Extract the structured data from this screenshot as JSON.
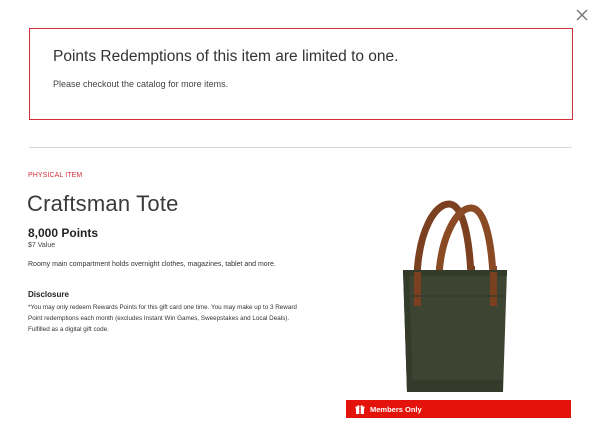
{
  "dialog": {
    "close_icon": "close-icon"
  },
  "alert": {
    "title": "Points Redemptions of this item are limited to one.",
    "message": "Please checkout the catalog for more items.",
    "border_color": "#d0303b"
  },
  "product": {
    "category": "PHYSICAL ITEM",
    "name": "Craftsman Tote",
    "points": "8,000 Points",
    "value": "$7 Value",
    "description": "Roomy main compartment holds overnight clothes, magazines, tablet and more.",
    "disclosure_heading": "Disclosure",
    "disclosure_text": "*You may only redeem Rewards Points for this gift card one time. You may make up to 3 Reward Point redemptions each month (excludes Instant Win Games, Sweepstakes and Local Deals). Fulfilled as a digital gift code.",
    "image_icon": "tote-bag-image"
  },
  "badge": {
    "label": "Members Only",
    "icon": "gift-icon",
    "color": "#e3120b"
  }
}
